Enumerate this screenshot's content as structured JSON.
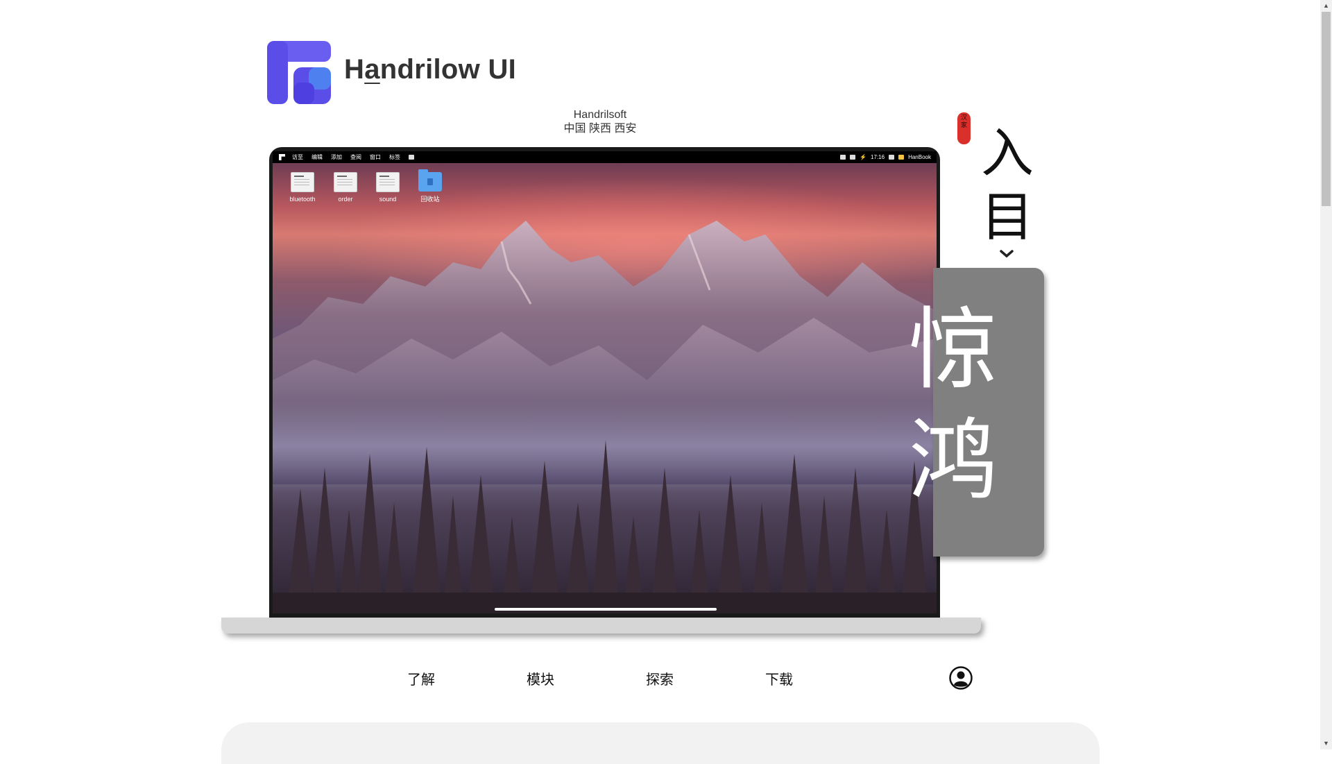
{
  "brand": {
    "name_prefix": "H",
    "name_underlined": "a",
    "name_suffix": "ndrilow UI"
  },
  "company": {
    "name": "Handrilsoft",
    "location": "中国 陕西 西安"
  },
  "desktop": {
    "menu_items": [
      "访至",
      "编辑",
      "添加",
      "查阅",
      "窗口",
      "标签"
    ],
    "tray": {
      "time": "17:16",
      "device": "HanBook"
    },
    "icons": [
      {
        "label": "bluetooth",
        "type": "document"
      },
      {
        "label": "order",
        "type": "document"
      },
      {
        "label": "sound",
        "type": "document"
      },
      {
        "label": "回收站",
        "type": "trash-folder"
      }
    ]
  },
  "side": {
    "seal_text": "汉家",
    "vertical_title": [
      "入",
      "目"
    ],
    "big_word": [
      "惊",
      "鸿"
    ]
  },
  "nav": {
    "items": [
      "了解",
      "模块",
      "探索",
      "下载"
    ]
  },
  "colors": {
    "card_gray": "#808080",
    "seal_red": "#d9302c",
    "logo_purple": "#5b4ee8"
  }
}
